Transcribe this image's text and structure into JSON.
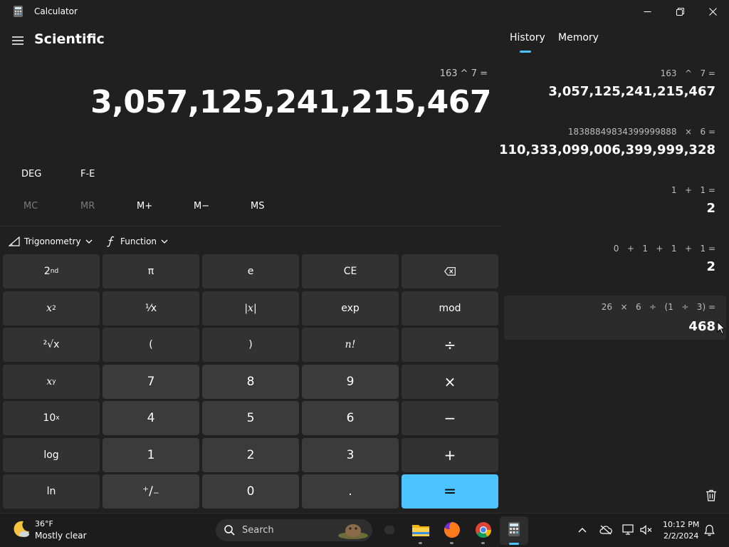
{
  "window": {
    "title": "Calculator"
  },
  "header": {
    "mode_title": "Scientific"
  },
  "display": {
    "expression": "163 ^ 7 =",
    "result": "3,057,125,241,215,467"
  },
  "angle_row": {
    "angle": "DEG",
    "fe": "F-E"
  },
  "memory_row": {
    "mc": "MC",
    "mr": "MR",
    "mplus": "M+",
    "mminus": "M−",
    "ms": "MS"
  },
  "dropdowns": {
    "trig": "Trigonometry",
    "func": "Function"
  },
  "keys": {
    "second": "2",
    "second_sup": "nd",
    "pi": "π",
    "e": "e",
    "ce": "CE",
    "square_base": "x",
    "square_sup": "2",
    "reciprocal": "¹⁄x",
    "abs": "|x|",
    "exp": "exp",
    "mod": "mod",
    "sqrt": "²√x",
    "lparen": "(",
    "rparen": ")",
    "factorial": "n!",
    "divide": "÷",
    "pow_base": "x",
    "pow_sup": "y",
    "seven": "7",
    "eight": "8",
    "nine": "9",
    "multiply": "×",
    "tenpow_base": "10",
    "tenpow_sup": "x",
    "four": "4",
    "five": "5",
    "six": "6",
    "minus": "−",
    "log": "log",
    "one": "1",
    "two": "2",
    "three": "3",
    "plus": "+",
    "ln": "ln",
    "negate": "⁺/₋",
    "zero": "0",
    "decimal": ".",
    "equals": "="
  },
  "history_panel": {
    "tabs": [
      "History",
      "Memory"
    ],
    "entries": [
      {
        "expression": "163   ^   7 =",
        "result": "3,057,125,241,215,467"
      },
      {
        "expression": "18388849834399999888   ×   6 =",
        "result": "110,333,099,006,399,999,328"
      },
      {
        "expression": "1   +   1 =",
        "result": "2"
      },
      {
        "expression": "0   +   1   +   1   +   1 =",
        "result": "2"
      },
      {
        "expression": "26   ×   6   ÷   (1   ÷   3) =",
        "result": "468"
      }
    ]
  },
  "taskbar": {
    "weather_temp": "36°F",
    "weather_desc": "Mostly clear",
    "search_label": "Search",
    "time": "10:12 PM",
    "date": "2/2/2024"
  },
  "colors": {
    "accent": "#4cc2ff",
    "background": "#202020",
    "key_number": "#3b3b3b",
    "key_function": "#323232"
  }
}
